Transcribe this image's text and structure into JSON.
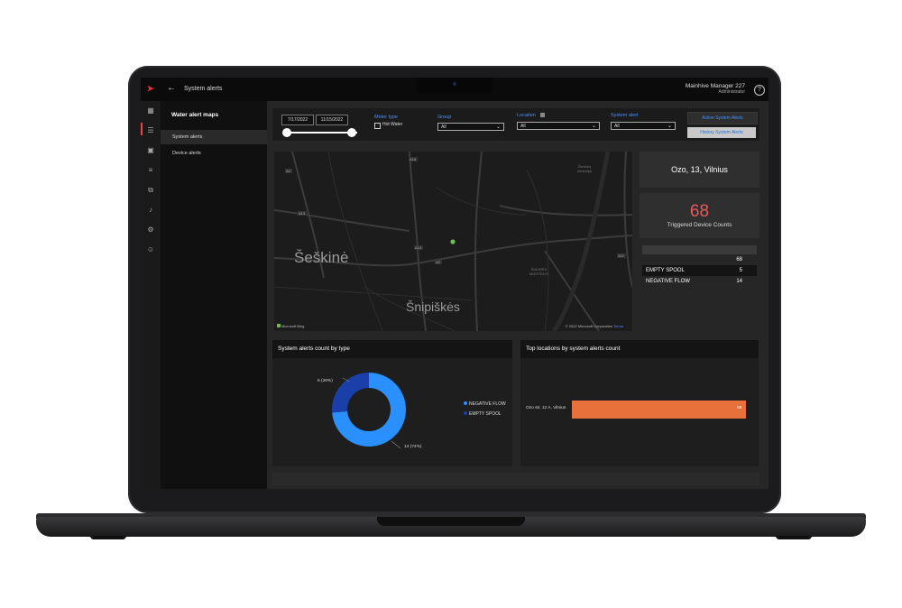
{
  "app": {
    "page_title": "System alerts",
    "back_icon": "arrow-left-icon",
    "user_name": "Mainhive Manager 227",
    "user_role": "Administrator",
    "help_icon": "help-icon"
  },
  "icon_rail": [
    "dashboard-icon",
    "list-icon",
    "image-icon",
    "menu-icon",
    "devices-icon",
    "bell-icon",
    "settings-icon",
    "user-icon"
  ],
  "nav": {
    "heading": "Water alert maps",
    "items": [
      {
        "label": "System alerts",
        "active": true
      },
      {
        "label": "Device alerts",
        "active": false
      }
    ]
  },
  "filters": {
    "date_from": "7/17/2022",
    "date_to": "11/15/2022",
    "meter_type_label": "Meter type",
    "hot_water_label": "Hot Water",
    "group_label": "Group",
    "group_value": "All",
    "location_label": "Location",
    "location_value": "All",
    "system_alert_label": "System alert",
    "system_alert_value": "All",
    "active_button": "Active System Alerts",
    "history_button": "History System Alerts"
  },
  "map": {
    "city_1": "Šeškinė",
    "city_2": "Šnipiškės",
    "district_1": "Žirmūnų\nseniūnija",
    "district_2": "ŠIAURĖS\nMIESTELIS",
    "road_labels": [
      "A2",
      "A16",
      "A13",
      "A14",
      "A2",
      "102"
    ],
    "attribution_left": "Microsoft Bing",
    "attribution_right": "© 2022 Microsoft Corporation",
    "terms": "Terms"
  },
  "location_card": {
    "text": "Ozo, 13, Vilnius"
  },
  "kpi": {
    "value": "68",
    "label": "Triggered Device Counts"
  },
  "alert_table": {
    "rows": [
      {
        "name": "",
        "value": "68"
      },
      {
        "name": "EMPTY SPOOL",
        "value": "5"
      },
      {
        "name": "NEGATIVE FLOW",
        "value": "14"
      }
    ]
  },
  "pie_panel": {
    "title": "System alerts count by type"
  },
  "bar_panel": {
    "title": "Top locations by system alerts count"
  },
  "colors": {
    "negative_flow": "#2a8fff",
    "empty_spool": "#1b3fa8",
    "bar": "#e8703a",
    "kpi": "#e85a5a"
  },
  "chart_data": [
    {
      "type": "pie",
      "title": "System alerts count by type",
      "series": [
        {
          "name": "NEGATIVE FLOW",
          "value": 14,
          "label": "14 (74%)"
        },
        {
          "name": "EMPTY SPOOL",
          "value": 5,
          "label": "5 (26%)"
        }
      ]
    },
    {
      "type": "bar",
      "title": "Top locations by system alerts count",
      "categories": [
        "Ozo str, 12 A, Vilnius"
      ],
      "values": [
        68
      ]
    }
  ]
}
